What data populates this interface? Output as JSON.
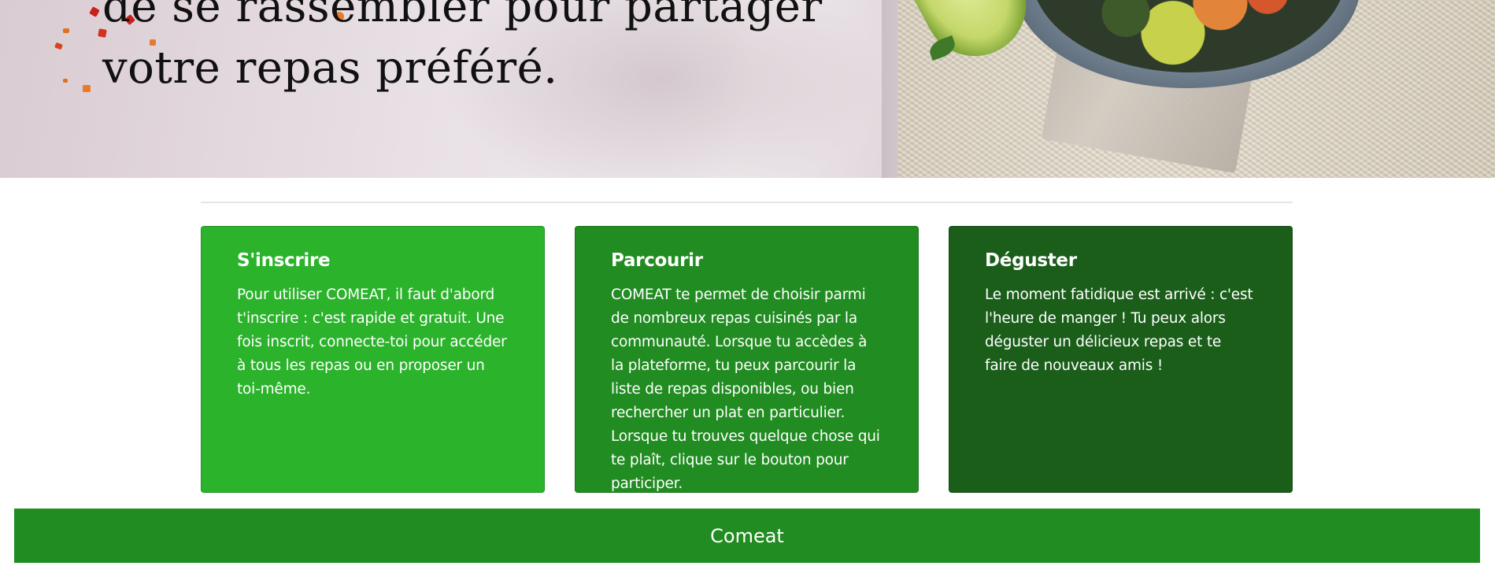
{
  "hero": {
    "title_line_1": "de se rassembler pour partager",
    "title_line_2": "votre repas préféré."
  },
  "cards": [
    {
      "title": "S'inscrire",
      "text": "Pour utiliser COMEAT, il faut d'abord t'inscrire : c'est rapide et gratuit. Une fois inscrit, connecte-toi pour accéder à tous les repas ou en proposer un toi-même.",
      "color": "#2bb32b"
    },
    {
      "title": "Parcourir",
      "text": "COMEAT te permet de choisir parmi de nombreux repas cuisinés par la communauté. Lorsque tu accèdes à la plateforme, tu peux parcourir la liste de repas disponibles, ou bien rechercher un plat en particulier. Lorsque tu trouves quelque chose qui te plaît, clique sur le bouton pour participer.",
      "color": "#218c21"
    },
    {
      "title": "Déguster",
      "text": "Le moment fatidique est arrivé : c'est l'heure de manger ! Tu peux alors déguster un délicieux repas et te faire de nouveaux amis !",
      "color": "#1a5e1a"
    }
  ],
  "footer": {
    "brand": "Comeat",
    "color": "#218c21"
  }
}
